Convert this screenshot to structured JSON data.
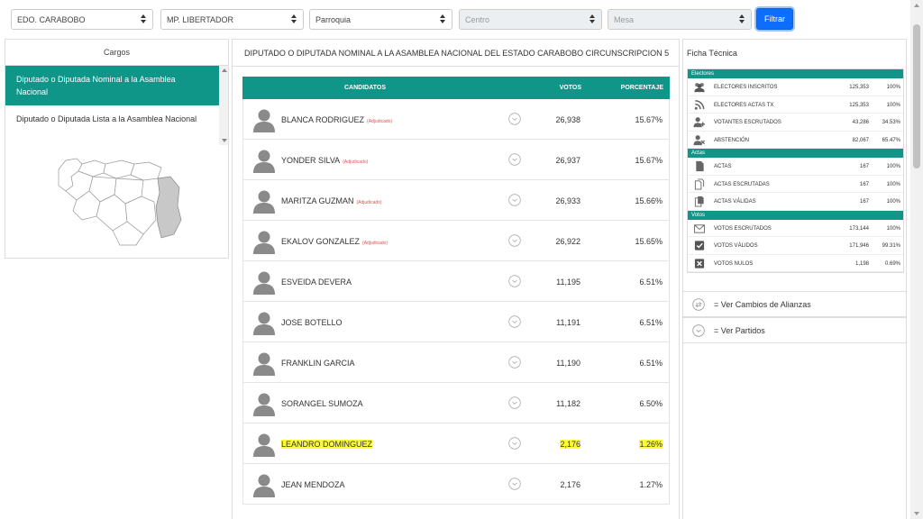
{
  "filters": {
    "estado": "EDO. CARABOBO",
    "municipio": "MP. LIBERTADOR",
    "parroquia": "Parroquia",
    "centro": "Centro",
    "mesa": "Mesa",
    "filtrar_label": "Filtrar"
  },
  "cargos": {
    "title": "Cargos",
    "items": [
      "Diputado o Diputada Nominal a la Asamblea Nacional",
      "Diputado o Diputada Lista a la Asamblea Nacional"
    ]
  },
  "main": {
    "title": "DIPUTADO O DIPUTADA NOMINAL A LA ASAMBLEA NACIONAL DEL ESTADO CARABOBO CIRCUNSCRIPCION 5",
    "headers": {
      "candidatos": "CANDIDATOS",
      "votos": "VOTOS",
      "porcentaje": "PORCENTAJE"
    },
    "rows": [
      {
        "name": "BLANCA RODRIGUEZ",
        "tag": "(Adjudicado)",
        "votes": "26,938",
        "pct": "15.67%"
      },
      {
        "name": "YONDER SILVA",
        "tag": "(Adjudicado)",
        "votes": "26,937",
        "pct": "15.67%"
      },
      {
        "name": "MARITZA GUZMAN",
        "tag": "(Adjudicado)",
        "votes": "26,933",
        "pct": "15.66%"
      },
      {
        "name": "EKALOV GONZALEZ",
        "tag": "(Adjudicado)",
        "votes": "26,922",
        "pct": "15.65%"
      },
      {
        "name": "ESVEIDA DEVERA",
        "tag": "",
        "votes": "11,195",
        "pct": "6.51%"
      },
      {
        "name": "JOSE BOTELLO",
        "tag": "",
        "votes": "11,191",
        "pct": "6.51%"
      },
      {
        "name": "FRANKLIN GARCIA",
        "tag": "",
        "votes": "11,190",
        "pct": "6.51%"
      },
      {
        "name": "SORANGEL SUMOZA",
        "tag": "",
        "votes": "11,182",
        "pct": "6.50%"
      },
      {
        "name": "LEANDRO DOMINGUEZ",
        "tag": "",
        "votes": "2,176",
        "pct": "1.26%",
        "highlight": true
      },
      {
        "name": "JEAN MENDOZA",
        "tag": "",
        "votes": "2,176",
        "pct": "1.27%"
      }
    ]
  },
  "ficha": {
    "title": "Ficha Técnica",
    "sections": [
      {
        "label": "Electores",
        "rows": [
          {
            "icon": "users-icon",
            "label": "ELECTORES INSCRITOS",
            "num": "125,353",
            "pct": "100%"
          },
          {
            "icon": "rss-icon",
            "label": "ELECTORES ACTAS TX",
            "num": "125,353",
            "pct": "100%"
          },
          {
            "icon": "user-plus-icon",
            "label": "VOTANTES ESCRUTADOS",
            "num": "43,286",
            "pct": "34.53%"
          },
          {
            "icon": "user-x-icon",
            "label": "ABSTENCIÓN",
            "num": "82,067",
            "pct": "65.47%"
          }
        ]
      },
      {
        "label": "Actas",
        "rows": [
          {
            "icon": "document-icon",
            "label": "ACTAS",
            "num": "167",
            "pct": "100%"
          },
          {
            "icon": "documents-icon",
            "label": "ACTAS ESCRUTADAS",
            "num": "167",
            "pct": "100%"
          },
          {
            "icon": "document-check-icon",
            "label": "ACTAS VÁLIDAS",
            "num": "167",
            "pct": "100%"
          }
        ]
      },
      {
        "label": "Votos",
        "rows": [
          {
            "icon": "envelope-icon",
            "label": "VOTOS ESCRUTADOS",
            "num": "173,144",
            "pct": "100%"
          },
          {
            "icon": "checkbox-icon",
            "label": "VOTOS VÁLIDOS",
            "num": "171,946",
            "pct": "99.31%"
          },
          {
            "icon": "x-box-icon",
            "label": "VOTOS NULOS",
            "num": "1,198",
            "pct": "0.69%"
          }
        ]
      }
    ],
    "ver_alianzas": "= Ver Cambios de Alianzas",
    "ver_partidos": "= Ver Partidos"
  },
  "colors": {
    "teal": "#109689",
    "primary": "#0d6efd",
    "highlight": "#fbfb3a",
    "adjudicado": "#e05252"
  }
}
